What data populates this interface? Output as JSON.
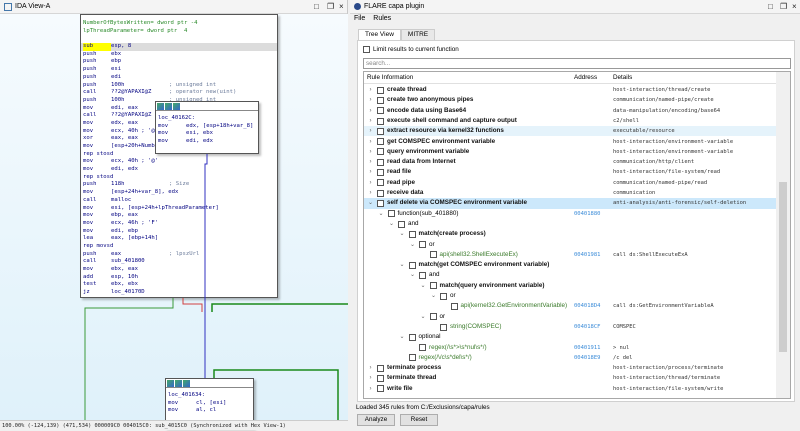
{
  "ida": {
    "title": "IDA View-A",
    "status": "100.00% (-124,139) (471,534) 000009C0 004015C0: sub_4015C0 (Synchronized with Hex View-1)",
    "header": [
      "NumberOfBytesWritten= dword ptr -4",
      "lpThreadParameter= dword ptr  4"
    ],
    "lines": [
      [
        "sub",
        "esp, 8",
        ""
      ],
      [
        "push",
        "ebx",
        ""
      ],
      [
        "push",
        "ebp",
        ""
      ],
      [
        "push",
        "esi",
        ""
      ],
      [
        "push",
        "edi",
        ""
      ],
      [
        "push",
        "100h",
        "; unsigned int"
      ],
      [
        "call",
        "??2@YAPAXI@Z",
        "; operator new(uint)"
      ],
      [
        "push",
        "100h",
        "; unsigned int"
      ],
      [
        "mov",
        "edi, eax",
        ""
      ],
      [
        "call",
        "??2@YAPAXI@Z",
        "; operator new(uint)"
      ],
      [
        "mov",
        "edx, eax",
        ""
      ],
      [
        "mov",
        "ecx, 40h ; '@'",
        ""
      ],
      [
        "xor",
        "eax, eax",
        ""
      ],
      [
        "mov",
        "[esp+20h+NumberOfBytesWritten], 0",
        ""
      ],
      [
        "rep stosd",
        "",
        ""
      ],
      [
        "mov",
        "ecx, 40h ; '@'",
        ""
      ],
      [
        "mov",
        "edi, edx",
        ""
      ],
      [
        "rep stosd",
        "",
        ""
      ],
      [
        "push",
        "118h",
        "; Size"
      ],
      [
        "mov",
        "[esp+24h+var_8], edx",
        ""
      ],
      [
        "call",
        "malloc",
        ""
      ],
      [
        "mov",
        "esi, [esp+24h+lpThreadParameter]",
        ""
      ],
      [
        "mov",
        "ebp, eax",
        ""
      ],
      [
        "mov",
        "ecx, 46h ; 'F'",
        ""
      ],
      [
        "mov",
        "edi, ebp",
        ""
      ],
      [
        "lea",
        "eax, [ebp+14h]",
        ""
      ],
      [
        "rep movsd",
        "",
        ""
      ],
      [
        "push",
        "eax",
        "; lpszUrl"
      ],
      [
        "call",
        "sub_401800",
        ""
      ],
      [
        "mov",
        "ebx, eax",
        ""
      ],
      [
        "add",
        "esp, 10h",
        ""
      ],
      [
        "test",
        "ebx, ebx",
        ""
      ],
      [
        "jz",
        "loc_40170D",
        ""
      ]
    ],
    "block2": {
      "label": "loc_40162C:",
      "lines": [
        [
          "mov",
          "edx, [esp+18h+var_8]",
          ""
        ],
        [
          "mov",
          "esi, ebx",
          ""
        ],
        [
          "mov",
          "edi, edx",
          ""
        ]
      ]
    },
    "block3": {
      "label": "loc_401634:",
      "lines": [
        [
          "mov",
          "cl, [esi]",
          ""
        ],
        [
          "mov",
          "al, cl",
          ""
        ]
      ]
    }
  },
  "capa": {
    "title": "FLARE capa plugin",
    "menu": [
      "File",
      "Rules"
    ],
    "tabs": [
      "Tree View",
      "MITRE"
    ],
    "limit_label": "Limit results to current function",
    "search_placeholder": "search...",
    "columns": [
      "Rule Information",
      "Address",
      "Details"
    ],
    "rows": [
      {
        "d": 0,
        "exp": ">",
        "t": "create thread",
        "s": "b",
        "a": "",
        "det": "host-interaction/thread/create"
      },
      {
        "d": 0,
        "exp": ">",
        "t": "create two anonymous pipes",
        "s": "b",
        "a": "",
        "det": "communication/named-pipe/create"
      },
      {
        "d": 0,
        "exp": ">",
        "t": "encode data using Base64",
        "s": "b",
        "a": "",
        "det": "data-manipulation/encoding/base64"
      },
      {
        "d": 0,
        "exp": ">",
        "t": "execute shell command and capture output",
        "s": "b",
        "a": "",
        "det": "c2/shell"
      },
      {
        "d": 0,
        "exp": ">",
        "t": "extract resource via kernel32 functions",
        "s": "b",
        "a": "",
        "det": "executable/resource",
        "state": "hov"
      },
      {
        "d": 0,
        "exp": ">",
        "t": "get COMSPEC environment variable",
        "s": "b",
        "a": "",
        "det": "host-interaction/environment-variable"
      },
      {
        "d": 0,
        "exp": ">",
        "t": "query environment variable",
        "s": "b",
        "a": "",
        "det": "host-interaction/environment-variable"
      },
      {
        "d": 0,
        "exp": ">",
        "t": "read data from Internet",
        "s": "b",
        "a": "",
        "det": "communication/http/client"
      },
      {
        "d": 0,
        "exp": ">",
        "t": "read file",
        "s": "b",
        "a": "",
        "det": "host-interaction/file-system/read"
      },
      {
        "d": 0,
        "exp": ">",
        "t": "read pipe",
        "s": "b",
        "a": "",
        "det": "communication/named-pipe/read"
      },
      {
        "d": 0,
        "exp": ">",
        "t": "receive data",
        "s": "b",
        "a": "",
        "det": "communication"
      },
      {
        "d": 0,
        "exp": "v",
        "t": "self delete via COMSPEC environment variable",
        "s": "b",
        "a": "",
        "det": "anti-analysis/anti-forensic/self-deletion",
        "state": "sel"
      },
      {
        "d": 1,
        "exp": "v",
        "t": "function(sub_401880)",
        "s": "",
        "a": "00401880",
        "det": ""
      },
      {
        "d": 2,
        "exp": "v",
        "t": "and",
        "s": "",
        "a": "",
        "det": ""
      },
      {
        "d": 3,
        "exp": "v",
        "t": "match(create process)",
        "s": "b",
        "a": "",
        "det": ""
      },
      {
        "d": 4,
        "exp": "v",
        "t": "or",
        "s": "",
        "a": "",
        "det": ""
      },
      {
        "d": 5,
        "exp": "",
        "t": "api(shell32.ShellExecuteEx)",
        "s": "g",
        "a": "00401981",
        "det": "call    ds:ShellExecuteExA"
      },
      {
        "d": 3,
        "exp": "v",
        "t": "match(get COMSPEC environment variable)",
        "s": "b",
        "a": "",
        "det": ""
      },
      {
        "d": 4,
        "exp": "v",
        "t": "and",
        "s": "",
        "a": "",
        "det": ""
      },
      {
        "d": 5,
        "exp": "v",
        "t": "match(query environment variable)",
        "s": "b",
        "a": "",
        "det": ""
      },
      {
        "d": 6,
        "exp": "v",
        "t": "or",
        "s": "",
        "a": "",
        "det": ""
      },
      {
        "d": 7,
        "exp": "",
        "t": "api(kernel32.GetEnvironmentVariable)",
        "s": "g",
        "a": "004018D4",
        "det": "call    ds:GetEnvironmentVariableA"
      },
      {
        "d": 5,
        "exp": "v",
        "t": "or",
        "s": "",
        "a": "",
        "det": ""
      },
      {
        "d": 6,
        "exp": "",
        "t": "string(COMSPEC)",
        "s": "g",
        "a": "004018CF",
        "det": "COMSPEC"
      },
      {
        "d": 3,
        "exp": "v",
        "t": "optional",
        "s": "",
        "a": "",
        "det": ""
      },
      {
        "d": 4,
        "exp": "",
        "t": "regex(/\\s*>\\s*nul\\s*/)",
        "s": "g",
        "a": "00401911",
        "det": " > nul"
      },
      {
        "d": 3,
        "exp": "",
        "t": "regex(/\\/c\\s*del\\s*/)",
        "s": "g",
        "a": "004018E9",
        "det": "/c del"
      },
      {
        "d": 0,
        "exp": ">",
        "t": "terminate process",
        "s": "b",
        "a": "",
        "det": "host-interaction/process/terminate"
      },
      {
        "d": 0,
        "exp": ">",
        "t": "terminate thread",
        "s": "b",
        "a": "",
        "det": "host-interaction/thread/terminate"
      },
      {
        "d": 0,
        "exp": ">",
        "t": "write file",
        "s": "b",
        "a": "",
        "det": "host-interaction/file-system/write"
      }
    ],
    "loaded": "Loaded 345 rules from C:/Exclusions/capa/rules",
    "analyze": "Analyze",
    "reset": "Reset"
  }
}
